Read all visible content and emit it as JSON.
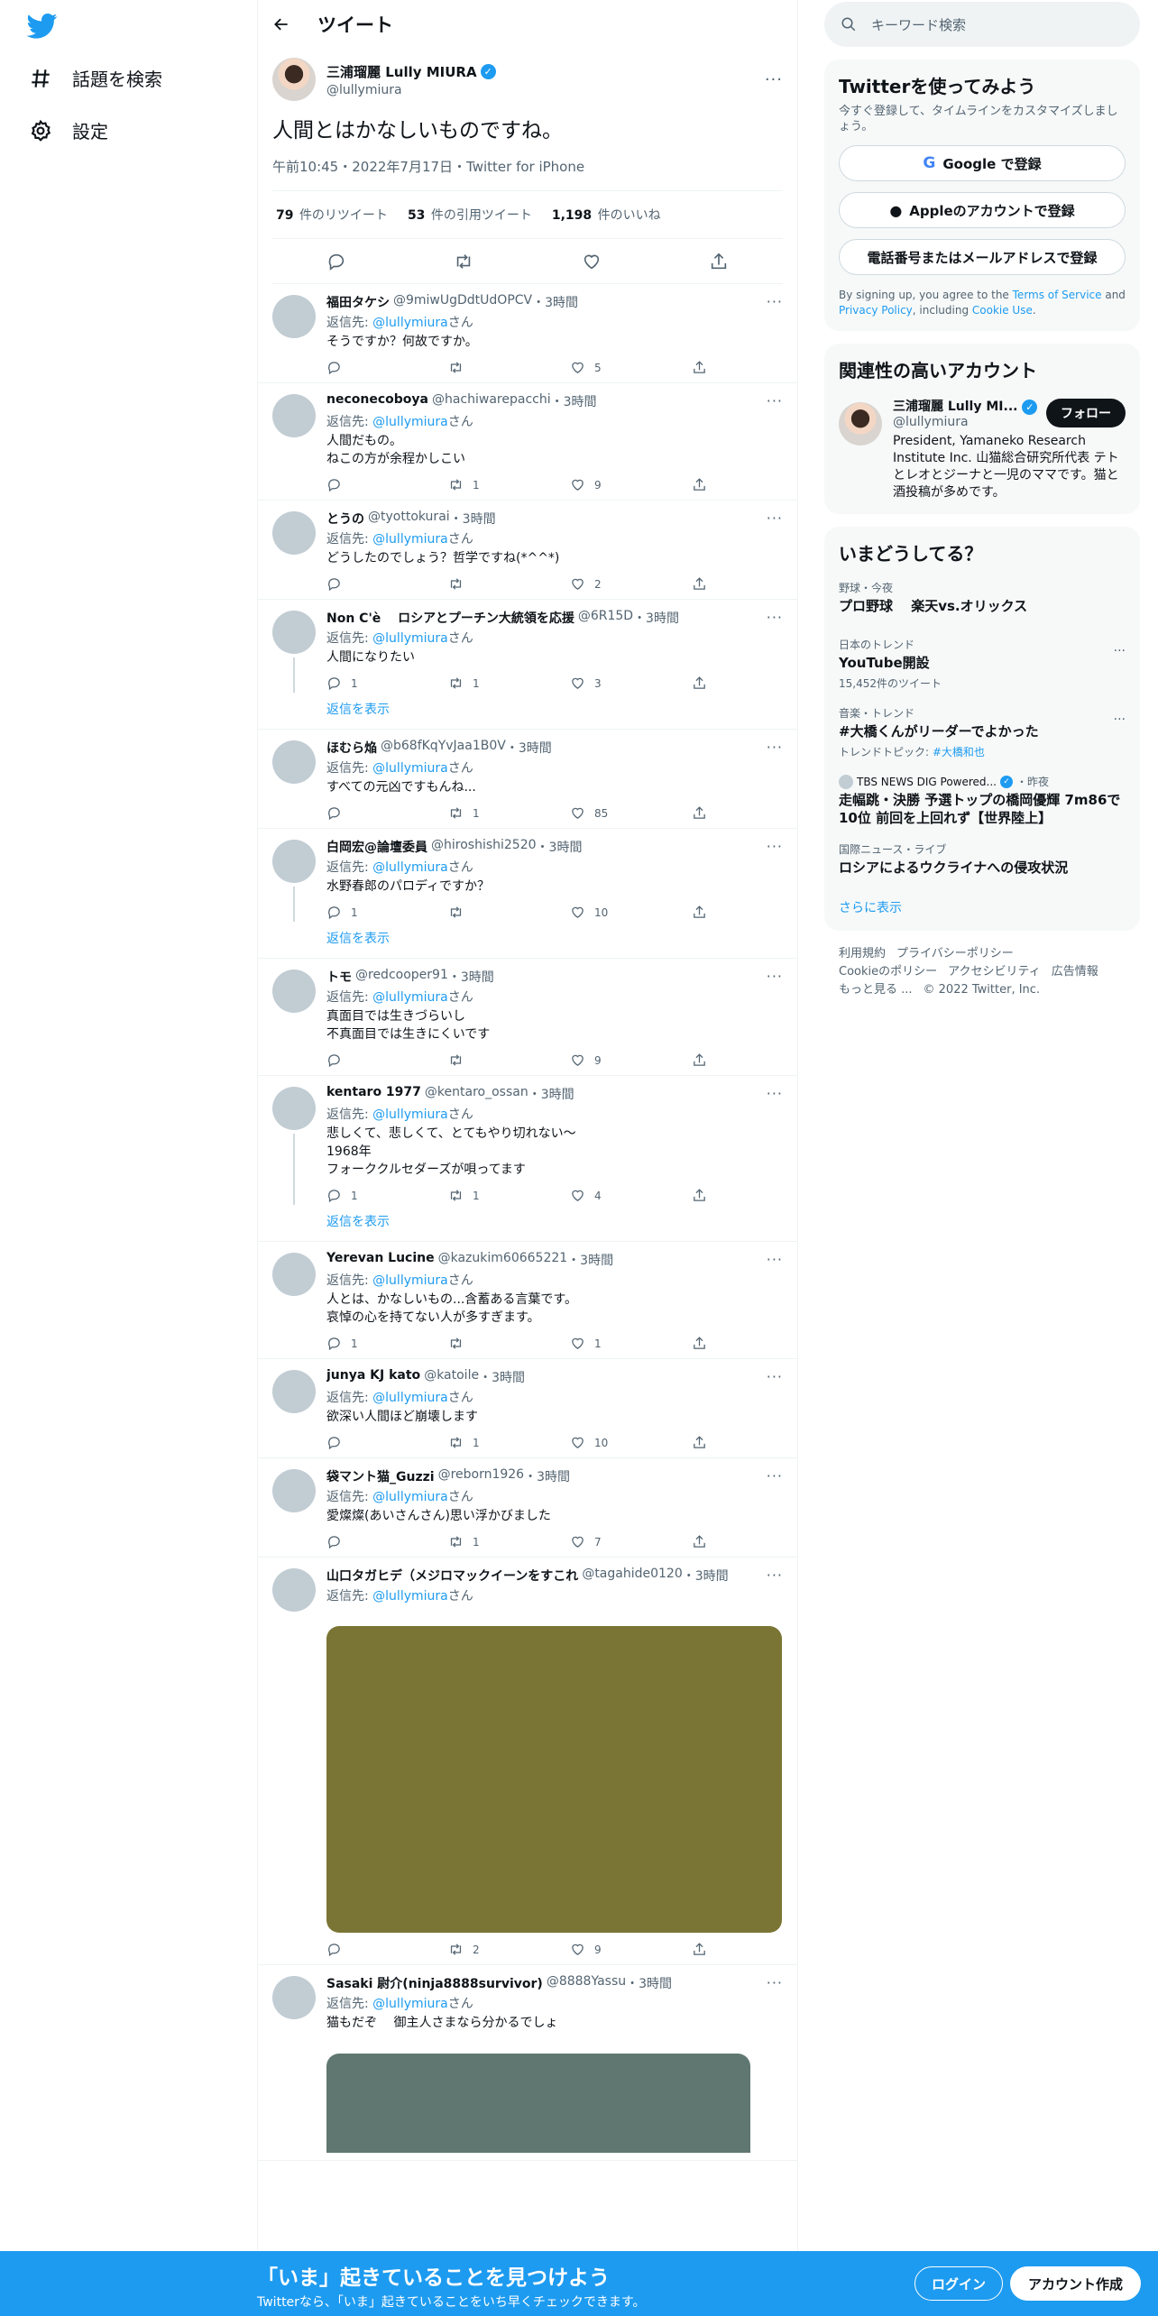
{
  "nav": {
    "explore": "話題を検索",
    "settings": "設定"
  },
  "header": {
    "title": "ツイート"
  },
  "main_tweet": {
    "name": "三浦瑠麗 Lully MIURA",
    "handle": "@lullymiura",
    "text": "人間とはかなしいものですね。",
    "time": "午前10:45・2022年7月17日・Twitter for iPhone",
    "retweets": "79",
    "retweets_label": "件のリツイート",
    "quotes": "53",
    "quotes_label": "件の引用ツイート",
    "likes": "1,198",
    "likes_label": "件のいいね"
  },
  "reply_to_label": "返信先: ",
  "reply_to_handle": "@lullymiura",
  "reply_to_suffix": "さん",
  "show_replies_label": "返信を表示",
  "replies": [
    {
      "name": "福田タケシ",
      "handle": "@9miwUgDdtUdOPCV",
      "time": "・3時間",
      "text": "そうですか？何故ですか。",
      "replies": "",
      "retweets": "",
      "likes": "5"
    },
    {
      "name": "neconecoboya",
      "handle": "@hachiwarepacchi",
      "time": "・3時間",
      "text": "人間だもの。\nねこの方が余程かしこい",
      "replies": "",
      "retweets": "1",
      "likes": "9"
    },
    {
      "name": "とうの",
      "handle": "@tyottokurai",
      "time": "・3時間",
      "text": "どうしたのでしょう？哲学ですね(*^^*)",
      "replies": "",
      "retweets": "",
      "likes": "2"
    },
    {
      "name": "Non C'è　 ロシアとプーチン大統領を応援",
      "handle": "@6R15D",
      "time": "・3時間",
      "text": "人間になりたい",
      "replies": "1",
      "retweets": "1",
      "likes": "3"
    },
    {
      "name": "ほむら焔",
      "handle": "@b68fKqYvJaa1B0V",
      "time": "・3時間",
      "text": "すべての元凶ですもんね...",
      "replies": "",
      "retweets": "1",
      "likes": "85"
    },
    {
      "name": "白岡宏@論壇委員",
      "handle": "@hiroshishi2520",
      "time": "・3時間",
      "text": "水野春郎のパロディですか？",
      "replies": "1",
      "retweets": "",
      "likes": "10"
    },
    {
      "name": "トモ",
      "handle": "@redcooper91",
      "time": "・3時間",
      "text": "真面目では生きづらいし\n不真面目では生きにくいです",
      "replies": "",
      "retweets": "",
      "likes": "9"
    },
    {
      "name": "kentaro 1977",
      "handle": "@kentaro_ossan",
      "time": "・3時間",
      "text": "悲しくて、悲しくて、とてもやり切れない〜\n1968年\nフォーククルセダーズが唄ってます",
      "replies": "1",
      "retweets": "1",
      "likes": "4"
    },
    {
      "name": "Yerevan Lucine",
      "handle": "@kazukim60665221",
      "time": "・3時間",
      "text": "人とは、かなしいもの...含蓄ある言葉です。\n哀悼の心を持てない人が多すぎます。",
      "replies": "1",
      "retweets": "",
      "likes": "1"
    },
    {
      "name": "junya KJ kato",
      "handle": "@katoile",
      "time": "・3時間",
      "text": "欲深い人間ほど崩壊します",
      "replies": "",
      "retweets": "1",
      "likes": "10"
    },
    {
      "name": "袋マント猫_Guzzi",
      "handle": "@reborn1926",
      "time": "・3時間",
      "text": "愛燦燦(あいさんさん)思い浮かびました",
      "replies": "",
      "retweets": "1",
      "likes": "7"
    },
    {
      "name": "山口タガヒデ（メジロマックイーンをすこれ",
      "handle": "@tagahide0120",
      "time": "・3時間",
      "text": "",
      "replies": "",
      "retweets": "2",
      "likes": "9"
    },
    {
      "name": "Sasaki 尉介(ninja8888survivor)",
      "handle": "@8888Yassu",
      "time": "・3時間",
      "text": "猫もだぞ　 御主人さまなら分かるでしょ"
    }
  ],
  "search": {
    "placeholder": "キーワード検索"
  },
  "signup_panel": {
    "title": "Twitterを使ってみよう",
    "sub": "今すぐ登録して、タイムラインをカスタマイズしましょう。",
    "google": "Google で登録",
    "apple": "Appleのアカウントで登録",
    "phone": "電話番号またはメールアドレスで登録",
    "terms_pre": "By signing up, you agree to the ",
    "terms_link": "Terms of Service",
    "terms_mid": " and ",
    "privacy_link": "Privacy Policy",
    "terms_mid2": ", including ",
    "cookie_link": "Cookie Use",
    "terms_end": "."
  },
  "related": {
    "title": "関連性の高いアカウント",
    "name": "三浦瑠麗 Lully MI...",
    "handle": "@lullymiura",
    "follow": "フォロー",
    "bio": "President, Yamaneko Research Institute Inc. 山猫総合研究所代表 テトとレオとジーナと一児のママです。猫と酒投稿が多めです。"
  },
  "trends": {
    "title": "いまどうしてる？",
    "items": [
      {
        "cat": "野球・今夜",
        "topic": "プロ野球　 楽天vs.オリックス",
        "meta": ""
      },
      {
        "cat": "日本のトレンド",
        "topic": "YouTube開設",
        "meta": "15,452件のツイート"
      },
      {
        "cat": "音楽・トレンド",
        "topic": "#大橋くんがリーダーでよかった",
        "meta_pre": "トレンドトピック: ",
        "meta_link": "#大橋和也"
      },
      {
        "source": "TBS NEWS DIG Powered...",
        "when": "・昨夜",
        "topic": "走幅跳・決勝 予選トップの橋岡優輝 7m86で10位 前回を上回れず【世界陸上】"
      },
      {
        "cat": "国際ニュース・ライブ",
        "topic": "ロシアによるウクライナへの侵攻状況"
      }
    ],
    "more": "さらに表示"
  },
  "footer": {
    "terms": "利用規約",
    "privacy": "プライバシーポリシー",
    "cookie": "Cookieのポリシー",
    "accessibility": "アクセシビリティ",
    "ads": "広告情報",
    "more": "もっと見る ...",
    "copyright": "© 2022 Twitter, Inc."
  },
  "bottom_bar": {
    "title": "「いま」起きていることを見つけよう",
    "sub": "Twitterなら、「いま」起きていることをいち早くチェックできます。",
    "login": "ログイン",
    "signup": "アカウント作成"
  },
  "colors": {
    "accent": "#1d9bf0",
    "text": "#0f1419",
    "muted": "#536471",
    "media1": "#7a7535",
    "media2": "#5f7770"
  }
}
